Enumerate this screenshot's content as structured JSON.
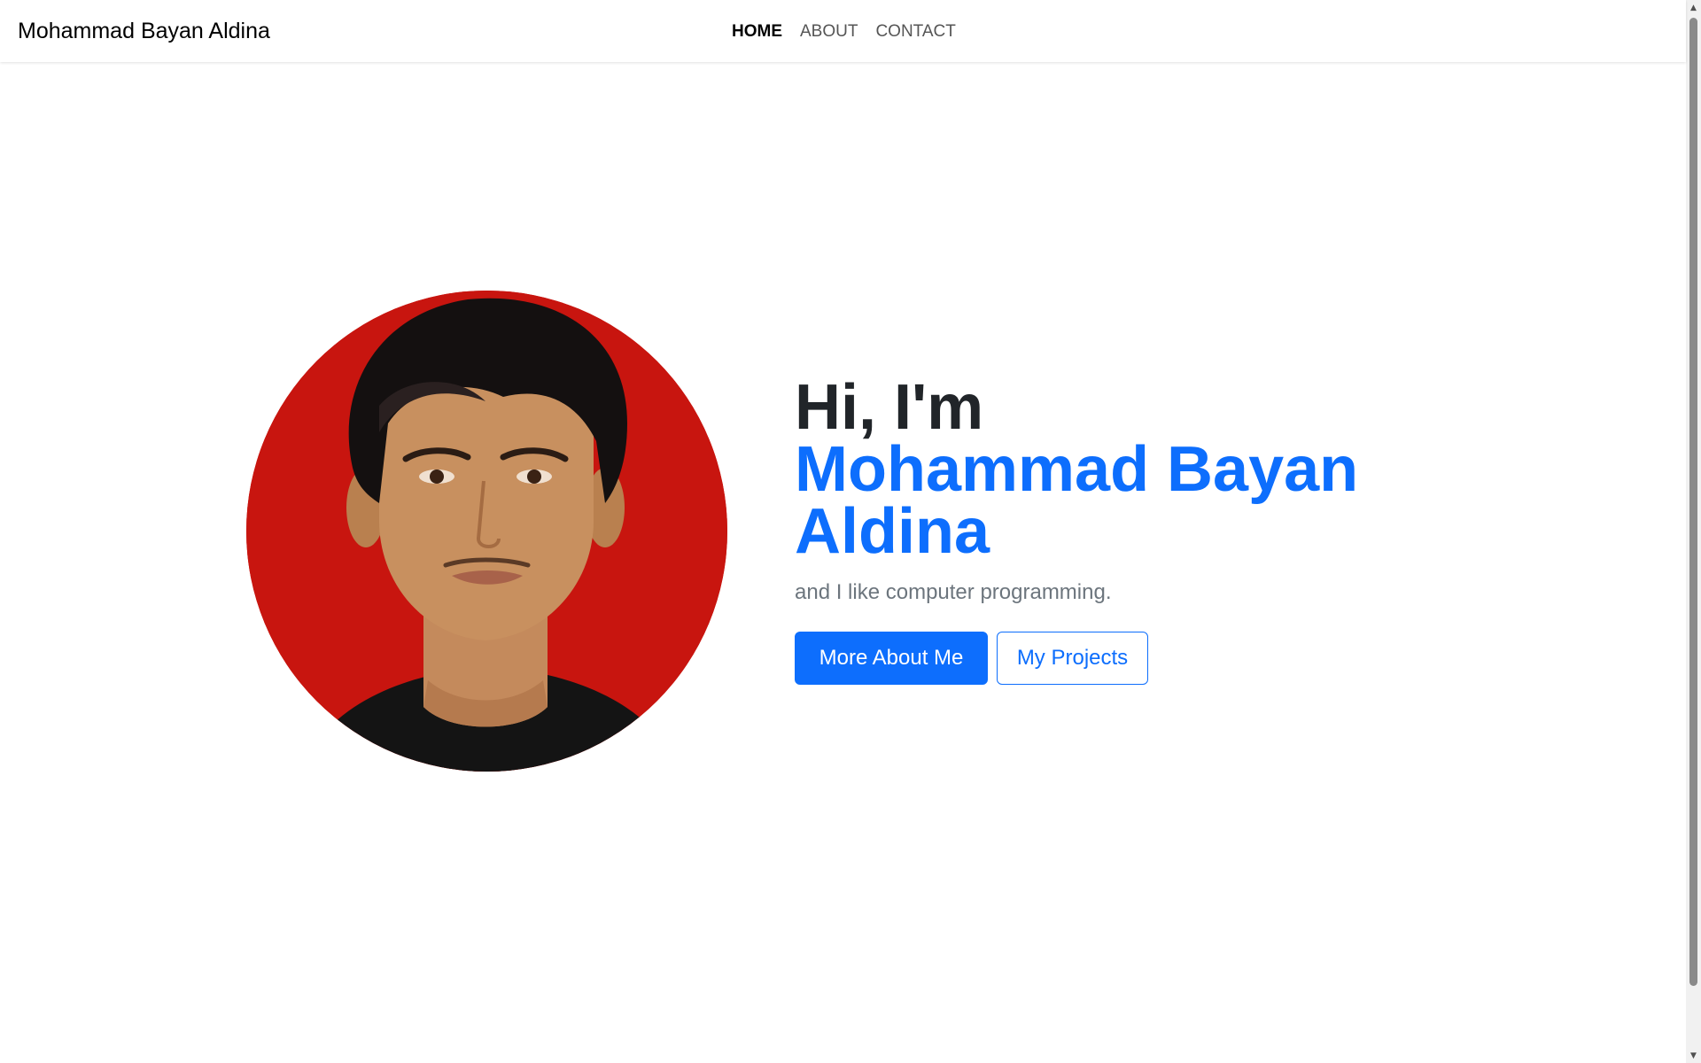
{
  "navbar": {
    "brand": "Mohammad Bayan Aldina",
    "links": [
      {
        "label": "HOME",
        "active": true
      },
      {
        "label": "ABOUT",
        "active": false
      },
      {
        "label": "CONTACT",
        "active": false
      }
    ]
  },
  "hero": {
    "greeting": "Hi, I'm",
    "name_line1": "Mohammad Bayan",
    "name_line2": "Aldina",
    "tagline": "and I like computer programming.",
    "primary_button": "More About Me",
    "secondary_button": "My Projects",
    "photo": {
      "subject": "portrait of a young man in black t-shirt",
      "background_color": "#c8150f"
    }
  },
  "colors": {
    "accent": "#0d6efd",
    "heading": "#212529",
    "muted": "#6c757d"
  },
  "icons": {
    "scroll_up": "triangle-up-icon",
    "scroll_down": "triangle-down-icon"
  }
}
